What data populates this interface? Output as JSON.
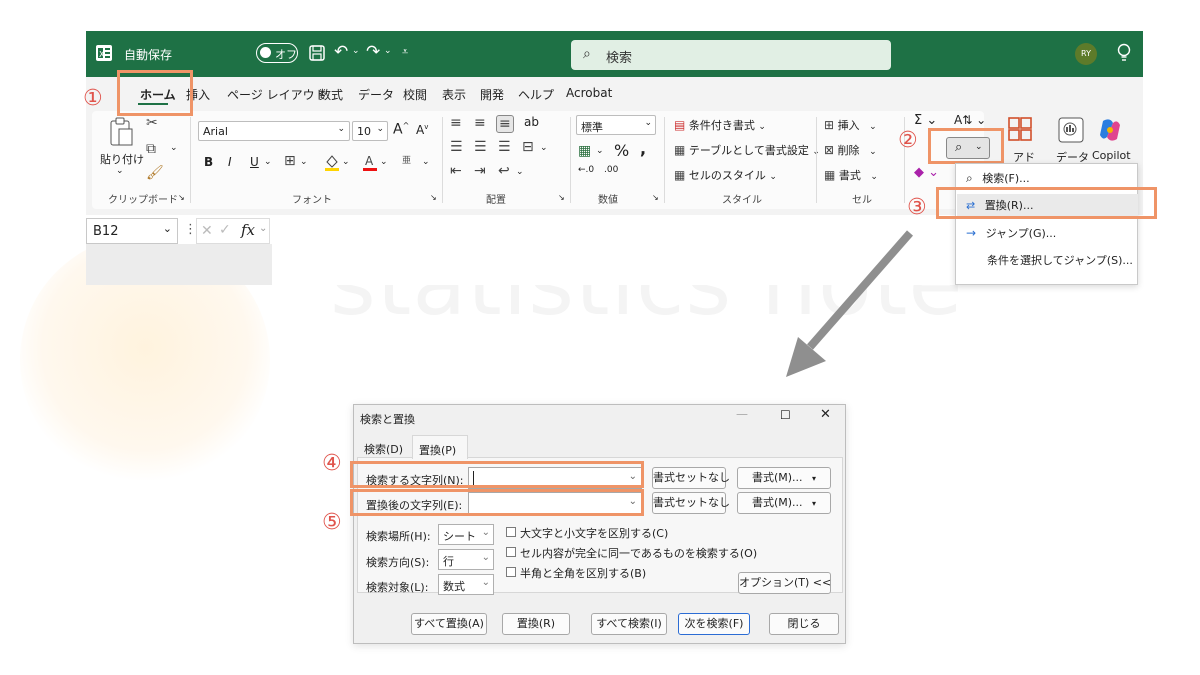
{
  "watermark": "statistics note",
  "window": {
    "autosave_label": "自動保存",
    "autosave_state": "オフ",
    "search_placeholder": "検索",
    "user_initials": "RY"
  },
  "tabs": [
    "ホーム",
    "挿入",
    "ページ レイアウト",
    "数式",
    "データ",
    "校閲",
    "表示",
    "開発",
    "ヘルプ",
    "Acrobat"
  ],
  "ribbon": {
    "paste_label": "貼り付け",
    "clipboard_group": "クリップボード",
    "font_name": "Arial",
    "font_size": "10",
    "font_group": "フォント",
    "alignment_group": "配置",
    "number_format": "標準",
    "number_group": "数値",
    "cond_format": "条件付き書式",
    "format_as_table": "テーブルとして書式設定",
    "cell_styles": "セルのスタイル",
    "styles_group": "スタイル",
    "insert_label": "挿入",
    "delete_label": "削除",
    "format_label": "書式",
    "cells_group": "セル",
    "addin_label": "アド",
    "data_label": "データ",
    "copilot_label": "Copilot"
  },
  "formula_bar": {
    "name_box": "B12",
    "fx_label": "fx"
  },
  "find_menu": {
    "items": [
      "検索(F)...",
      "置換(R)...",
      "ジャンプ(G)...",
      "条件を選択してジャンプ(S)..."
    ]
  },
  "markers": [
    "①",
    "②",
    "③",
    "④",
    "⑤"
  ],
  "dialog": {
    "title": "検索と置換",
    "tab_find": "検索(D)",
    "tab_replace": "置換(P)",
    "find_label": "検索する文字列(N):",
    "replace_label": "置換後の文字列(E):",
    "no_format_button": "書式セットなし",
    "format_button": "書式(M)...",
    "within_label": "検索場所(H):",
    "within_value": "シート",
    "search_label": "検索方向(S):",
    "search_value": "行",
    "lookin_label": "検索対象(L):",
    "lookin_value": "数式",
    "match_case": "大文字と小文字を区別する(C)",
    "match_entire": "セル内容が完全に同一であるものを検索する(O)",
    "match_byte": "半角と全角を区別する(B)",
    "options_button": "オプション(T) <<",
    "replace_all": "すべて置換(A)",
    "replace": "置換(R)",
    "find_all": "すべて検索(I)",
    "find_next": "次を検索(F)",
    "close": "閉じる"
  },
  "colors": {
    "excel_green": "#1e7145",
    "highlight_orange": "#ef9467",
    "marker_red": "#e0544c"
  }
}
